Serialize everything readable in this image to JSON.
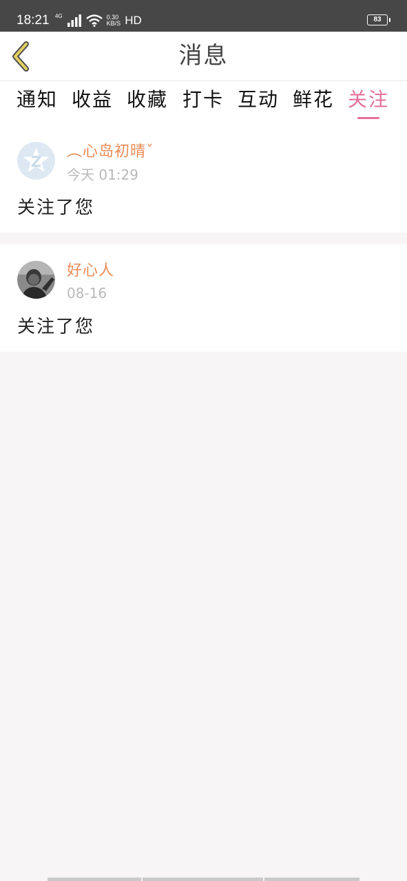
{
  "status_bar": {
    "time": "18:21",
    "network_label": "4G",
    "speed_value": "0.30",
    "speed_unit": "KB/S",
    "hd_label": "HD",
    "battery": "83"
  },
  "header": {
    "title": "消息",
    "back_icon": "chevron-left-icon",
    "accent_color": "#e3d064"
  },
  "tabs": [
    {
      "label": "通知",
      "active": false
    },
    {
      "label": "收益",
      "active": false
    },
    {
      "label": "收藏",
      "active": false
    },
    {
      "label": "打卡",
      "active": false
    },
    {
      "label": "互动",
      "active": false
    },
    {
      "label": "鲜花",
      "active": false
    },
    {
      "label": "关注",
      "active": true
    }
  ],
  "active_tab_color": "#e36f9b",
  "notifications": [
    {
      "username": "︵心岛初晴ˇ",
      "time": "今天 01:29",
      "message": "关注了您",
      "avatar_icon": "default-star-avatar-icon"
    },
    {
      "username": "好心人",
      "time": "08-16",
      "message": "关注了您",
      "avatar_icon": "user-photo-avatar"
    }
  ],
  "colors": {
    "username": "#e98b55",
    "time": "#b9b9b9",
    "page_background": "#f7f5f5"
  }
}
